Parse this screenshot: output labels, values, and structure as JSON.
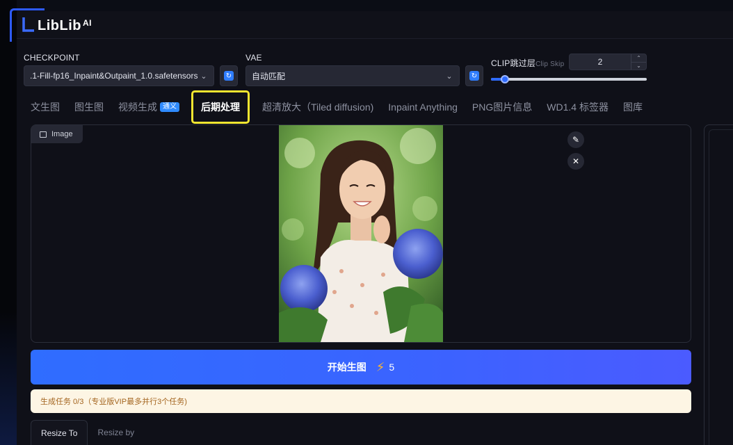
{
  "app": {
    "logo_text": "LibLib",
    "logo_sup": "AI"
  },
  "checkpoint": {
    "label": "CHECKPOINT",
    "value": ".1-Fill-fp16_Inpaint&Outpaint_1.0.safetensors"
  },
  "vae": {
    "label": "VAE",
    "value": "自动匹配"
  },
  "clip": {
    "label": "CLIP跳过层",
    "sub_label": "Clip Skip",
    "value": "2",
    "slider_fraction": 0.09
  },
  "tabs": [
    {
      "label": "文生图"
    },
    {
      "label": "图生图"
    },
    {
      "label": "视频生成",
      "badge": "通义"
    },
    {
      "label": "后期处理"
    },
    {
      "label": "超清放大（Tiled diffusion)"
    },
    {
      "label": "Inpaint Anything"
    },
    {
      "label": "PNG图片信息"
    },
    {
      "label": "WD1.4 标签器"
    },
    {
      "label": "图库"
    }
  ],
  "image_panel": {
    "chip_label": "Image"
  },
  "generate": {
    "label": "开始生图",
    "cost": "5"
  },
  "status": {
    "text": "生成任务 0/3（专业版VIP最多并行3个任务)"
  },
  "resize_tabs": [
    {
      "label": "Resize To"
    },
    {
      "label": "Resize by"
    }
  ],
  "colors": {
    "accent": "#2f6bff",
    "highlight": "#f3e530",
    "bolt": "#ffb52e",
    "status_bg": "#fdf5e4",
    "status_text": "#a4651f"
  }
}
